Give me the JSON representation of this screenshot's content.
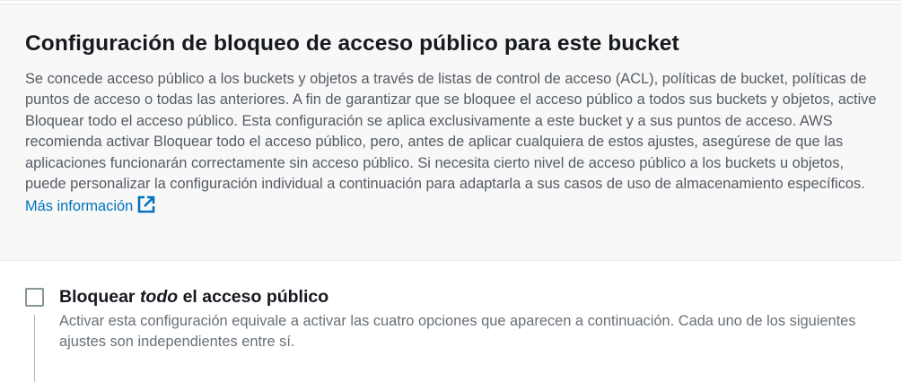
{
  "panel": {
    "title": "Configuración de bloqueo de acceso público para este bucket",
    "description": "Se concede acceso público a los buckets y objetos a través de listas de control de acceso (ACL), políticas de bucket, políticas de puntos de acceso o todas las anteriores. A fin de garantizar que se bloquee el acceso público a todos sus buckets y objetos, active Bloquear todo el acceso público. Esta configuración se aplica exclusivamente a este bucket y a sus puntos de acceso. AWS recomienda activar Bloquear todo el acceso público, pero, antes de aplicar cualquiera de estos ajustes, asegúrese de que las aplicaciones funcionarán correctamente sin acceso público. Si necesita cierto nivel de acceso público a los buckets u objetos, puede personalizar la configuración individual a continuación para adaptarla a sus casos de uso de almacenamiento específicos.",
    "more_info_link": "Más información",
    "link_icon": "external-link-icon"
  },
  "block_all": {
    "label_prefix": "Bloquear ",
    "label_emphasis": "todo",
    "label_suffix": " el acceso público",
    "description": "Activar esta configuración equivale a activar las cuatro opciones que aparecen a continuación. Cada uno de los siguientes ajustes son independientes entre sí.",
    "checked": false
  },
  "colors": {
    "link": "#0073bb",
    "panel_bg": "#f8f8f8",
    "text_secondary": "#545b64",
    "checkbox_border": "#879596"
  }
}
